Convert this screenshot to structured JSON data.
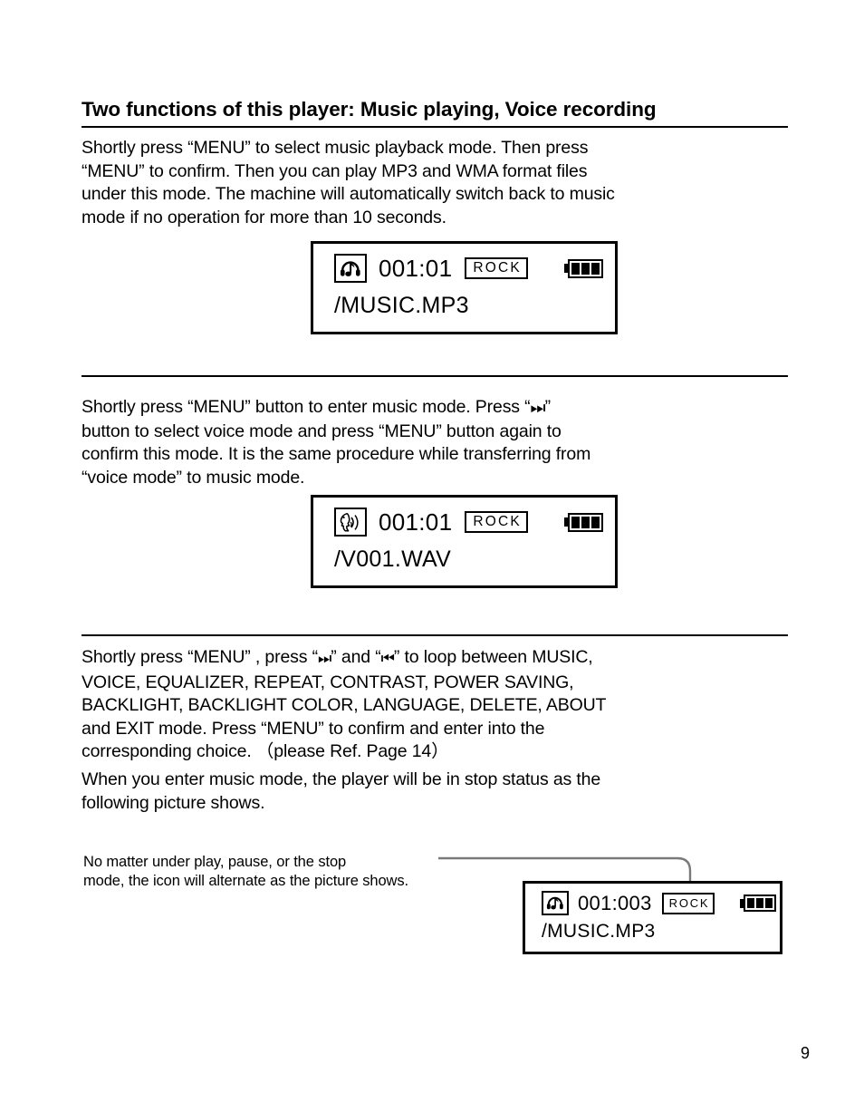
{
  "page": {
    "title": "Two functions of this player: Music playing, Voice recording",
    "number": "9"
  },
  "sections": {
    "music_mode": {
      "lines": [
        "Shortly press “MENU” to select music playback mode. Then press",
        " “MENU” to confirm. Then you can play MP3 and WMA format files",
        "under this mode. The machine will automatically switch back to music",
        "mode if no operation for more than 10 seconds."
      ]
    },
    "voice_mode": {
      "line1_a": "Shortly press “MENU” button to enter music mode. Press “",
      "line1_icon": "⏭",
      "line1_b": "”",
      "line2": "button to select voice mode and press “MENU” button again to",
      "line3": "confirm this mode. It is the same procedure while transferring from",
      "line4": " “voice mode” to music mode."
    },
    "menu_loop": {
      "line1_a": "Shortly press “MENU” , press “",
      "line1_icon_next": "⏭",
      "line1_b": "”  and  “",
      "line1_icon_prev": "⏮",
      "line1_c": "” to loop between MUSIC,",
      "line2": "VOICE,  EQUALIZER, REPEAT, CONTRAST, POWER SAVING,",
      "line3": "BACKLIGHT, BACKLIGHT COLOR, LANGUAGE, DELETE,  ABOUT",
      "line4": "and EXIT mode. Press “MENU” to confirm and enter into the",
      "line5": "corresponding choice. （please Ref. Page 14）"
    },
    "stop_status": {
      "line1": "When you enter music mode, the player will be in stop status as the",
      "line2": "following picture shows."
    },
    "icon_callout": {
      "line1": "No matter under play, pause, or the stop",
      "line2": "mode, the icon will alternate as the picture shows."
    }
  },
  "screens": [
    {
      "id": "music-playing",
      "mode_icon": "headphone-note-icon",
      "time": "001:01",
      "equalizer": "ROCK",
      "battery_bars": 3,
      "filename": "/MUSIC.MP3"
    },
    {
      "id": "voice-recording",
      "mode_icon": "voice-face-icon",
      "time": "001:01",
      "equalizer": "ROCK",
      "battery_bars": 3,
      "filename": "/V001.WAV"
    },
    {
      "id": "music-stopped",
      "mode_icon": "headphone-note-icon",
      "time": "001:003",
      "equalizer": "ROCK",
      "battery_bars": 3,
      "filename": "/MUSIC.MP3"
    }
  ],
  "colors": {
    "text": "#000000",
    "background": "#ffffff",
    "leader_line": "#7a7a7a"
  }
}
